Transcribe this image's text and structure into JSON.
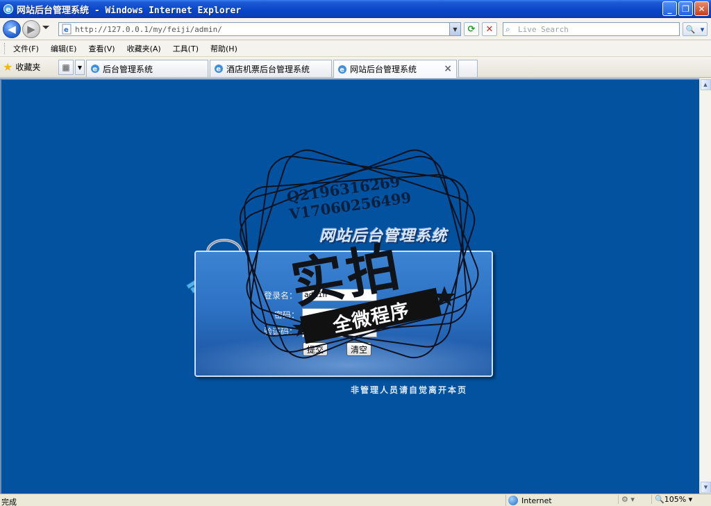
{
  "window": {
    "title": "网站后台管理系统 - Windows Internet Explorer",
    "buttons": {
      "minimize": "_",
      "restore": "❐",
      "close": "✕"
    }
  },
  "address_bar": {
    "url": "http://127.0.0.1/my/feiji/admin/",
    "search_placeholder": "Live Search"
  },
  "menu": {
    "items": [
      "文件(F)",
      "编辑(E)",
      "查看(V)",
      "收藏夹(A)",
      "工具(T)",
      "帮助(H)"
    ]
  },
  "tabs_bar": {
    "favorites_label": "收藏夹",
    "tabs": [
      {
        "label": "后台管理系统",
        "active": false
      },
      {
        "label": "酒店机票后台管理系统",
        "active": false
      },
      {
        "label": "网站后台管理系统",
        "active": true
      }
    ],
    "close_glyph": "×"
  },
  "page": {
    "site_title": "网站后台管理系统",
    "login": {
      "username_label": "登录名：",
      "username_value": "admin",
      "password_label": "密码：",
      "password_value": "",
      "captcha_label": "验证码：",
      "captcha_value": "",
      "submit_label": "提交",
      "clear_label": "清空"
    },
    "notice": "非管理人员请自觉离开本页",
    "watermark": {
      "contact_1": "Q2196316269",
      "contact_2": "V17060256499",
      "big_text": "实拍",
      "ribbon_text": "全微程序"
    }
  },
  "status_bar": {
    "status": "完成",
    "zone": "Internet",
    "zoom": "105%"
  },
  "colors": {
    "page_background": "#03529f",
    "title_bar": "#0a46c8",
    "panel": "#2d72c4"
  }
}
